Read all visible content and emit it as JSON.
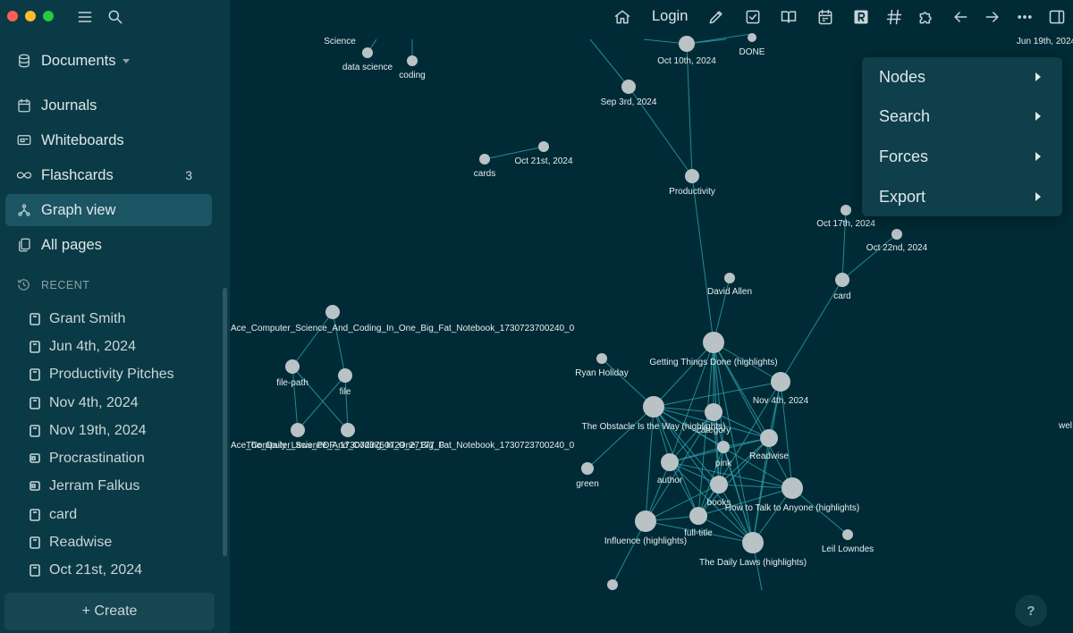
{
  "sidebar": {
    "nav": {
      "documents": "Documents",
      "journals": "Journals",
      "whiteboards": "Whiteboards",
      "flashcards": "Flashcards",
      "flashcards_count": "3",
      "graph_view": "Graph view",
      "all_pages": "All pages"
    },
    "recent_heading": "RECENT",
    "recent": [
      "Grant Smith",
      "Jun 4th, 2024",
      "Productivity Pitches",
      "Nov 4th, 2024",
      "Nov 19th, 2024",
      "Procrastination",
      "Jerram Falkus",
      "card",
      "Readwise",
      "Oct 21st, 2024"
    ],
    "create_label": "+ Create"
  },
  "topbar": {
    "login_label": "Login",
    "icons": [
      "home-icon",
      "pencil-icon",
      "checkbox-icon",
      "book-icon",
      "calendar-icon",
      "readwise-icon",
      "hashtag-icon",
      "puzzle-icon",
      "arrow-left-icon",
      "arrow-right-icon",
      "more-icon",
      "sidebar-toggle-icon"
    ]
  },
  "graph": {
    "labels": [
      "Science",
      "data science",
      "coding",
      "Oct 10th, 2024",
      "DONE",
      "Jun 19th, 2024",
      "Sep 3rd, 2024",
      "cards",
      "Oct 21st, 2024",
      "Productivity",
      "Oct 17th, 2024",
      "Oct 22nd, 2024",
      "card",
      "David Allen",
      "Ace_Computer_Science_And_Coding_In_One_Big_Fat_Notebook_1730723700240_0",
      "Getting Things Done (highlights)",
      "Ryan Holiday",
      "file-path",
      "file",
      "Nov 4th, 2024",
      "The Obstacle Is the Way (highlights)",
      "category",
      "wel",
      "Readwise",
      "pink",
      "green",
      "author",
      "books",
      "How to Talk to Anyone (highlights)",
      "full-title",
      "Influence (highlights)",
      "Leil Lowndes",
      "The Daily Laws (highlights)"
    ],
    "overlap_label_a": "Ace_Computer_Science_And_Coding_In_One_Big_Fat_Notebook_1730723700240_0",
    "overlap_label_b": "The_Daily_Laws_PDF_1730723750729_27177_0"
  },
  "context_menu": [
    "Nodes",
    "Search",
    "Forces",
    "Export"
  ],
  "help_label": "?",
  "colors": {
    "background": "#002b36",
    "sidebar": "#0a3a45",
    "active": "#1b5563",
    "edge": "#2a9aa8",
    "node": "#b9c2c5"
  }
}
